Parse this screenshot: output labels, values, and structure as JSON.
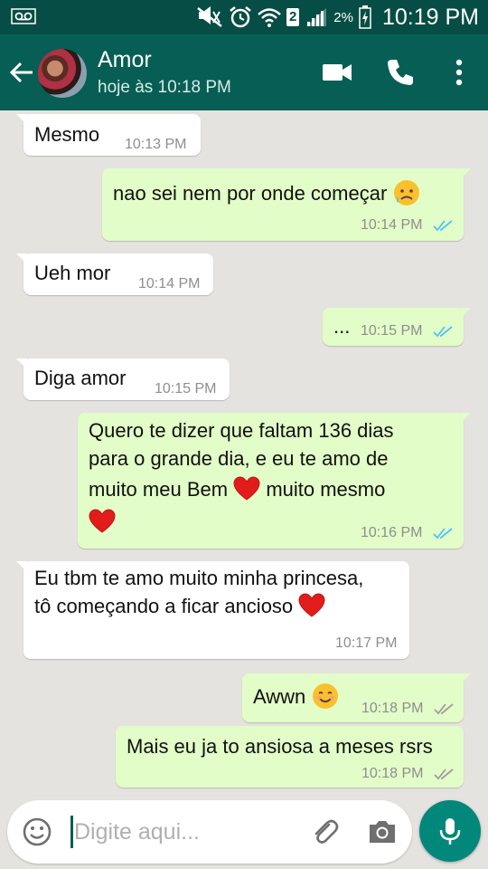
{
  "status_bar": {
    "sim": "2",
    "battery": "2%",
    "time": "10:19 PM"
  },
  "header": {
    "contact_name": "Amor",
    "contact_status": "hoje às 10:18 PM"
  },
  "messages": [
    {
      "direction": "in",
      "text": "Mesmo",
      "time": "10:13 PM"
    },
    {
      "direction": "out",
      "text": "nao sei nem por onde começar",
      "emoji": "sad-face",
      "time": "10:14 PM",
      "status": "read"
    },
    {
      "direction": "in",
      "text": "Ueh mor",
      "time": "10:14 PM"
    },
    {
      "direction": "out",
      "text": "...",
      "time": "10:15 PM",
      "status": "read"
    },
    {
      "direction": "in",
      "text": "Diga amor",
      "time": "10:15 PM"
    },
    {
      "direction": "out",
      "lines": [
        "Quero te dizer que faltam 136 dias",
        "para o grande dia, e eu te amo de",
        "muito meu Bem",
        "muito mesmo"
      ],
      "emoji": "red-heart",
      "time": "10:16 PM",
      "status": "read"
    },
    {
      "direction": "in",
      "lines": [
        "Eu tbm te amo muito minha princesa,",
        "tô começando a ficar ancioso"
      ],
      "emoji": "red-heart",
      "time": "10:17 PM"
    },
    {
      "direction": "out",
      "text": "Awwn",
      "emoji": "smiling-face",
      "time": "10:18 PM",
      "status": "delivered"
    },
    {
      "direction": "out",
      "text": "Mais eu ja to ansiosa a meses rsrs",
      "time": "10:18 PM",
      "status": "delivered"
    }
  ],
  "input": {
    "placeholder": "Digite aqui..."
  },
  "colors": {
    "header": "#075e54",
    "status_bar": "#064d45",
    "outgoing_bubble": "#e2fdc7",
    "incoming_bubble": "#ffffff",
    "chat_background": "#e5e3e0",
    "read_ticks": "#4fc3f7",
    "mic_button": "#02887b"
  },
  "icons": [
    "voicemail-icon",
    "mute-icon",
    "alarm-icon",
    "wifi-icon",
    "signal-icon",
    "battery-icon",
    "back-arrow-icon",
    "video-call-icon",
    "phone-icon",
    "more-vert-icon",
    "emoji-icon",
    "attach-icon",
    "camera-icon",
    "mic-icon"
  ]
}
